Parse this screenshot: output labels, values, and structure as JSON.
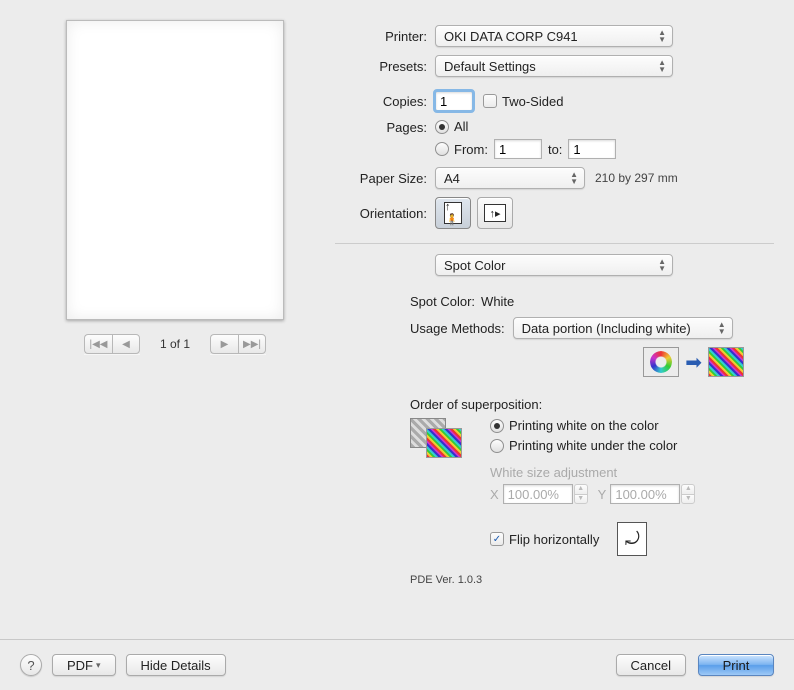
{
  "labels": {
    "printer": "Printer:",
    "presets": "Presets:",
    "copies": "Copies:",
    "two_sided": "Two-Sided",
    "pages": "Pages:",
    "all": "All",
    "from": "From:",
    "to": "to:",
    "paper_size": "Paper Size:",
    "orientation": "Orientation:",
    "spot_color_label": "Spot Color:",
    "usage_methods": "Usage Methods:",
    "order_super": "Order of superposition:",
    "supr_opt1": "Printing white on the color",
    "supr_opt2": "Printing white under the color",
    "white_size_adj": "White size adjustment",
    "x": "X",
    "y": "Y",
    "flip": "Flip horizontally",
    "pde": "PDE Ver.  1.0.3"
  },
  "values": {
    "printer": "OKI DATA CORP C941",
    "presets": "Default Settings",
    "copies": "1",
    "from": "1",
    "to": "1",
    "paper_size": "A4",
    "paper_size_dim": "210 by 297 mm",
    "panel_select": "Spot Color",
    "spot_color": "White",
    "usage_method": "Data portion (Including white)",
    "x_pct": "100.00%",
    "y_pct": "100.00%",
    "page_indicator": "1 of 1"
  },
  "footer": {
    "pdf": "PDF",
    "hide_details": "Hide Details",
    "cancel": "Cancel",
    "print": "Print"
  }
}
